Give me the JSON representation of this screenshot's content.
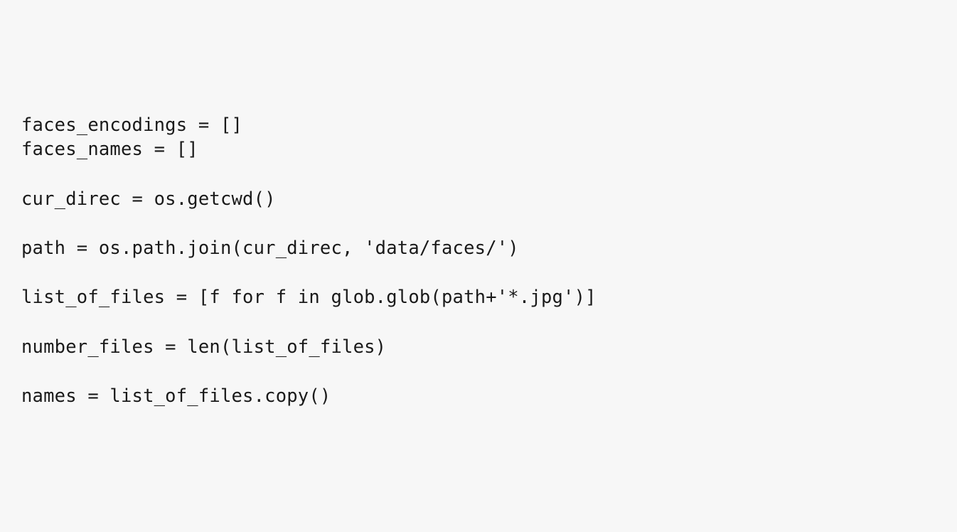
{
  "code": {
    "line1": "faces_encodings = []",
    "line2": "faces_names = []",
    "line3": "cur_direc = os.getcwd()",
    "line4": "path = os.path.join(cur_direc, 'data/faces/')",
    "line5": "list_of_files = [f for f in glob.glob(path+'*.jpg')]",
    "line6": "number_files = len(list_of_files)",
    "line7": "names = list_of_files.copy()"
  }
}
